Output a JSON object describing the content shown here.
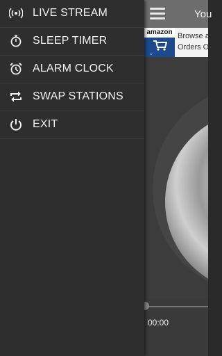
{
  "app": {
    "title": "You",
    "ad": {
      "brand": "amazon",
      "line1": "Browse a",
      "line2": "Orders O"
    },
    "time": "00:00"
  },
  "drawer": {
    "items": [
      {
        "label": "LIVE STREAM",
        "icon": "broadcast-icon"
      },
      {
        "label": "SLEEP TIMER",
        "icon": "stopwatch-icon"
      },
      {
        "label": "ALARM CLOCK",
        "icon": "alarm-clock-icon"
      },
      {
        "label": "SWAP STATIONS",
        "icon": "swap-icon"
      },
      {
        "label": "EXIT",
        "icon": "power-icon"
      }
    ]
  }
}
